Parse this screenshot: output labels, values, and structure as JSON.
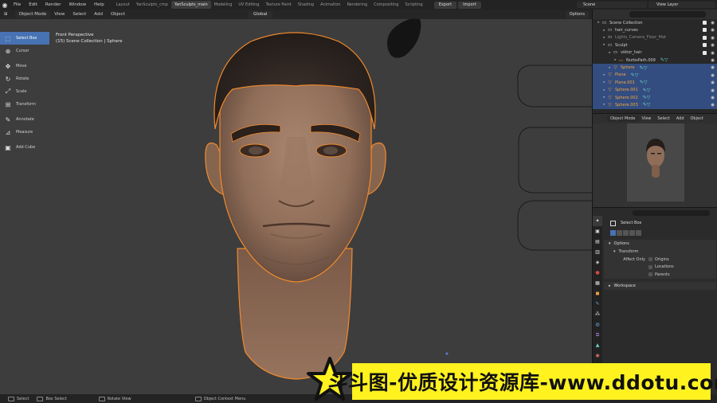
{
  "topbar": {
    "menus": [
      "File",
      "Edit",
      "Render",
      "Window",
      "Help"
    ],
    "workspaces": [
      {
        "label": "Layout",
        "active": false
      },
      {
        "label": "YanSculpts_cmp",
        "active": false
      },
      {
        "label": "YanSculpts_main",
        "active": true
      },
      {
        "label": "Modeling",
        "active": false
      },
      {
        "label": "UV Editing",
        "active": false
      },
      {
        "label": "Texture Paint",
        "active": false
      },
      {
        "label": "Shading",
        "active": false
      },
      {
        "label": "Animation",
        "active": false
      },
      {
        "label": "Rendering",
        "active": false
      },
      {
        "label": "Compositing",
        "active": false
      },
      {
        "label": "Scripting",
        "active": false
      }
    ],
    "export_label": "Export",
    "import_label": "Import",
    "scene": "Scene",
    "view_layer": "View Layer"
  },
  "viewport": {
    "mode": "Object Mode",
    "menus": [
      "View",
      "Select",
      "Add",
      "Object"
    ],
    "orientation": "Global",
    "options_label": "Options",
    "info_line1": "Front Perspective",
    "info_line2": "(15) Scene Collection | Sphere"
  },
  "toolbar": {
    "tools": [
      {
        "label": "Select Box",
        "icon": "select-box-icon",
        "active": true
      },
      {
        "label": "Cursor",
        "icon": "cursor-icon",
        "active": false
      },
      {
        "label": "Move",
        "icon": "move-icon",
        "active": false
      },
      {
        "label": "Rotate",
        "icon": "rotate-icon",
        "active": false
      },
      {
        "label": "Scale",
        "icon": "scale-icon",
        "active": false
      },
      {
        "label": "Transform",
        "icon": "transform-icon",
        "active": false
      },
      {
        "label": "Annotate",
        "icon": "annotate-icon",
        "active": false
      },
      {
        "label": "Measure",
        "icon": "measure-icon",
        "active": false
      },
      {
        "label": "Add Cube",
        "icon": "add-cube-icon",
        "active": false
      }
    ]
  },
  "outliner": {
    "rows": [
      {
        "label": "Scene Collection",
        "indent": 0,
        "icon": "collection-icon",
        "style": "normal",
        "selected": false
      },
      {
        "label": "hair_curves",
        "indent": 1,
        "icon": "collection-icon",
        "style": "normal",
        "selected": false
      },
      {
        "label": "Lights_Camera_Floor_Mat",
        "indent": 1,
        "icon": "collection-icon",
        "style": "dim",
        "selected": false
      },
      {
        "label": "Sculpt",
        "indent": 1,
        "icon": "collection-icon",
        "style": "normal",
        "selected": false
      },
      {
        "label": "viktor_hair",
        "indent": 2,
        "icon": "collection-icon",
        "style": "normal",
        "selected": false
      },
      {
        "label": "NurbsPath.009",
        "indent": 3,
        "icon": "curve-icon",
        "style": "normal",
        "selected": false
      },
      {
        "label": "Sphere",
        "indent": 2,
        "icon": "mesh-icon",
        "style": "orange",
        "selected": true
      },
      {
        "label": "Plane",
        "indent": 1,
        "icon": "mesh-icon",
        "style": "orange",
        "selected": true
      },
      {
        "label": "Plane.001",
        "indent": 1,
        "icon": "mesh-icon",
        "style": "orange",
        "selected": true
      },
      {
        "label": "Sphere.001",
        "indent": 1,
        "icon": "mesh-icon",
        "style": "orange",
        "selected": true
      },
      {
        "label": "Sphere.002",
        "indent": 1,
        "icon": "mesh-icon",
        "style": "orange",
        "selected": true
      },
      {
        "label": "Sphere.003",
        "indent": 1,
        "icon": "mesh-icon",
        "style": "orange",
        "selected": true
      }
    ]
  },
  "preview": {
    "mode": "Object Mode",
    "menus": [
      "View",
      "Select",
      "Add",
      "Object"
    ]
  },
  "properties": {
    "active_tool": "Select Box",
    "options_label": "Options",
    "transform_label": "Transform",
    "affect_only_label": "Affect Only",
    "affect_options": [
      "Origins",
      "Locations",
      "Parents"
    ],
    "workspace_label": "Workspace"
  },
  "statusbar": {
    "items": [
      "Select",
      "Box Select",
      "Rotate View",
      "Object Context Menu"
    ]
  },
  "watermark": {
    "text": "斗斗图-优质设计资源库-www.ddotu.com"
  },
  "colors": {
    "accent": "#4772b3",
    "selection_outline": "#f08a2c",
    "outliner_selected": "#334d80",
    "watermark_yellow": "#fff21f"
  }
}
